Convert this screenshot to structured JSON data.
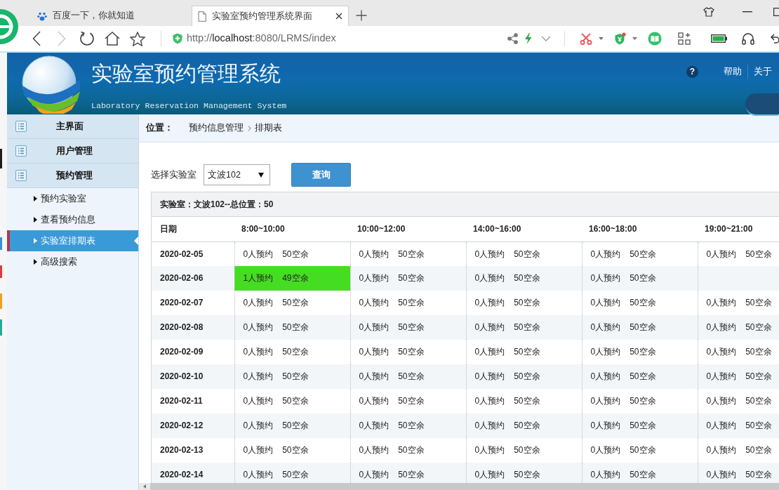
{
  "browser": {
    "tabs": [
      {
        "title": "百度一下，你就知道",
        "selected": false
      },
      {
        "title": "实验室预约管理系统界面",
        "selected": true
      }
    ],
    "nav_buttons": [
      {
        "kind": "back",
        "disabled": false
      },
      {
        "kind": "forward",
        "disabled": true
      },
      {
        "kind": "reload",
        "disabled": false
      },
      {
        "kind": "home",
        "disabled": false
      },
      {
        "kind": "favorite",
        "disabled": false
      }
    ],
    "url": {
      "scheme": "http://",
      "host": "localhost",
      "path": ":8080/LRMS/index"
    }
  },
  "header": {
    "title": "实验室预约管理系统",
    "subtitle": "Laboratory Reservation Management System",
    "help_symbol": "?",
    "links": [
      "帮助",
      "关于"
    ]
  },
  "sidebar": {
    "groups": [
      {
        "label": "主界面"
      },
      {
        "label": "用户管理"
      },
      {
        "label": "预约管理",
        "items": [
          {
            "label": "预约实验室",
            "selected": false
          },
          {
            "label": "查看预约信息",
            "selected": false
          },
          {
            "label": "实验室排期表",
            "selected": true
          },
          {
            "label": "高级搜索",
            "selected": false
          }
        ]
      }
    ]
  },
  "breadcrumb": {
    "label": "位置：",
    "items": [
      "预约信息管理",
      "排期表"
    ]
  },
  "filter": {
    "label": "选择实验室",
    "value": "文波102",
    "button": "查询"
  },
  "schedule": {
    "caption": "实验室：文波102--总位置：50",
    "columns": [
      "日期",
      "8:00~10:00",
      "10:00~12:00",
      "14:00~16:00",
      "16:00~18:00",
      "19:00~21:00"
    ],
    "rows": [
      {
        "date": "2020-02-05",
        "slots": [
          {
            "booked": "0人预约",
            "free": "50空余",
            "highlighted": false
          },
          {
            "booked": "0人预约",
            "free": "50空余",
            "highlighted": false
          },
          {
            "booked": "0人预约",
            "free": "50空余",
            "highlighted": false
          },
          {
            "booked": "0人预约",
            "free": "50空余",
            "highlighted": false
          },
          {
            "booked": "0人预约",
            "free": "50空余",
            "highlighted": false
          }
        ]
      },
      {
        "date": "2020-02-06",
        "slots": [
          {
            "booked": "1人预约",
            "free": "49空余",
            "highlighted": true
          },
          {
            "booked": "0人预约",
            "free": "50空余",
            "highlighted": false
          },
          {
            "booked": "0人预约",
            "free": "50空余",
            "highlighted": false
          },
          {
            "booked": "0人预约",
            "free": "50空余",
            "highlighted": false
          }
        ]
      },
      {
        "date": "2020-02-07",
        "slots": [
          {
            "booked": "0人预约",
            "free": "50空余",
            "highlighted": false
          },
          {
            "booked": "0人预约",
            "free": "50空余",
            "highlighted": false
          },
          {
            "booked": "0人预约",
            "free": "50空余",
            "highlighted": false
          },
          {
            "booked": "0人预约",
            "free": "50空余",
            "highlighted": false
          },
          {
            "booked": "0人预约",
            "free": "50空余",
            "highlighted": false
          }
        ]
      },
      {
        "date": "2020-02-08",
        "slots": [
          {
            "booked": "0人预约",
            "free": "50空余",
            "highlighted": false
          },
          {
            "booked": "0人预约",
            "free": "50空余",
            "highlighted": false
          },
          {
            "booked": "0人预约",
            "free": "50空余",
            "highlighted": false
          },
          {
            "booked": "0人预约",
            "free": "50空余",
            "highlighted": false
          },
          {
            "booked": "0人预约",
            "free": "50空余",
            "highlighted": false
          }
        ]
      },
      {
        "date": "2020-02-09",
        "slots": [
          {
            "booked": "0人预约",
            "free": "50空余",
            "highlighted": false
          },
          {
            "booked": "0人预约",
            "free": "50空余",
            "highlighted": false
          },
          {
            "booked": "0人预约",
            "free": "50空余",
            "highlighted": false
          },
          {
            "booked": "0人预约",
            "free": "50空余",
            "highlighted": false
          },
          {
            "booked": "0人预约",
            "free": "50空余",
            "highlighted": false
          }
        ]
      },
      {
        "date": "2020-02-10",
        "slots": [
          {
            "booked": "0人预约",
            "free": "50空余",
            "highlighted": false
          },
          {
            "booked": "0人预约",
            "free": "50空余",
            "highlighted": false
          },
          {
            "booked": "0人预约",
            "free": "50空余",
            "highlighted": false
          },
          {
            "booked": "0人预约",
            "free": "50空余",
            "highlighted": false
          },
          {
            "booked": "0人预约",
            "free": "50空余",
            "highlighted": false
          }
        ]
      },
      {
        "date": "2020-02-11",
        "slots": [
          {
            "booked": "0人预约",
            "free": "50空余",
            "highlighted": false
          },
          {
            "booked": "0人预约",
            "free": "50空余",
            "highlighted": false
          },
          {
            "booked": "0人预约",
            "free": "50空余",
            "highlighted": false
          },
          {
            "booked": "0人预约",
            "free": "50空余",
            "highlighted": false
          },
          {
            "booked": "0人预约",
            "free": "50空余",
            "highlighted": false
          }
        ]
      },
      {
        "date": "2020-02-12",
        "slots": [
          {
            "booked": "0人预约",
            "free": "50空余",
            "highlighted": false
          },
          {
            "booked": "0人预约",
            "free": "50空余",
            "highlighted": false
          },
          {
            "booked": "0人预约",
            "free": "50空余",
            "highlighted": false
          },
          {
            "booked": "0人预约",
            "free": "50空余",
            "highlighted": false
          },
          {
            "booked": "0人预约",
            "free": "50空余",
            "highlighted": false
          }
        ]
      },
      {
        "date": "2020-02-13",
        "slots": [
          {
            "booked": "0人预约",
            "free": "50空余",
            "highlighted": false
          },
          {
            "booked": "0人预约",
            "free": "50空余",
            "highlighted": false
          },
          {
            "booked": "0人预约",
            "free": "50空余",
            "highlighted": false
          },
          {
            "booked": "0人预约",
            "free": "50空余",
            "highlighted": false
          },
          {
            "booked": "0人预约",
            "free": "50空余",
            "highlighted": false
          }
        ]
      },
      {
        "date": "2020-02-14",
        "slots": [
          {
            "booked": "0人预约",
            "free": "50空余",
            "highlighted": false
          },
          {
            "booked": "0人预约",
            "free": "50空余",
            "highlighted": false
          },
          {
            "booked": "0人预约",
            "free": "50空余",
            "highlighted": false
          },
          {
            "booked": "0人预约",
            "free": "50空余",
            "highlighted": false
          },
          {
            "booked": "0人预约",
            "free": "50空余",
            "highlighted": false
          }
        ]
      }
    ]
  }
}
